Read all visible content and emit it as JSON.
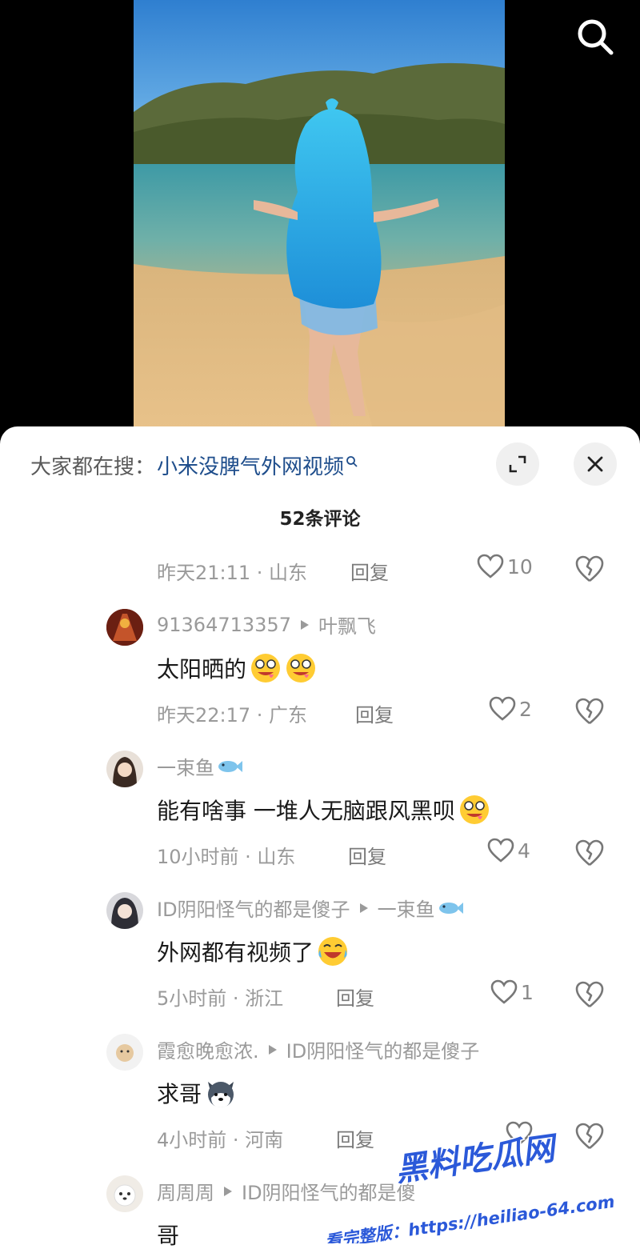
{
  "hot_search": {
    "prefix": "大家都在搜：",
    "query": "小米没脾气外网视频"
  },
  "comment_count": "52条评论",
  "reply_label": "回复",
  "first_row_meta": {
    "time": "昨天21:11 · 山东",
    "likes": "10"
  },
  "comments": [
    {
      "author": "91364713357",
      "reply_to": "叶飘飞",
      "text": "太阳晒的",
      "emoji": [
        "drooling-face-emoji",
        "drooling-face-emoji"
      ],
      "time": "昨天22:17 · 广东",
      "likes": "2"
    },
    {
      "author": "一束鱼",
      "author_suffix_icon": "fish-icon",
      "reply_to": "",
      "text": "能有啥事 一堆人无脑跟风黑呗",
      "emoji": [
        "drooling-face-emoji"
      ],
      "time": "10小时前 · 山东",
      "likes": "4"
    },
    {
      "author": "ID阴阳怪气的都是傻子",
      "reply_to": "一束鱼",
      "reply_to_icon": "fish-icon",
      "text": "外网都有视频了",
      "emoji": [
        "crying-laughing-emoji"
      ],
      "time": "5小时前 · 浙江",
      "likes": "1"
    },
    {
      "author": "霞愈晚愈浓.",
      "reply_to": "ID阴阳怪气的都是傻子",
      "text": "求哥",
      "emoji": [
        "husky-dog-emoji"
      ],
      "time": "4小时前 · 河南",
      "likes": ""
    },
    {
      "author": "周周周",
      "reply_to": "ID阴阳怪气的都是傻",
      "text": "哥",
      "emoji": [],
      "time": "",
      "likes": ""
    }
  ],
  "watermark": {
    "title": "黑料吃瓜网",
    "line": "看完整版：https://heiliao-64.com"
  },
  "colors": {
    "sheet_bg": "#ffffff",
    "query_link": "#1f4e8c",
    "meta_gray": "#9a9a9a",
    "watermark_blue": "#2b59d9"
  }
}
